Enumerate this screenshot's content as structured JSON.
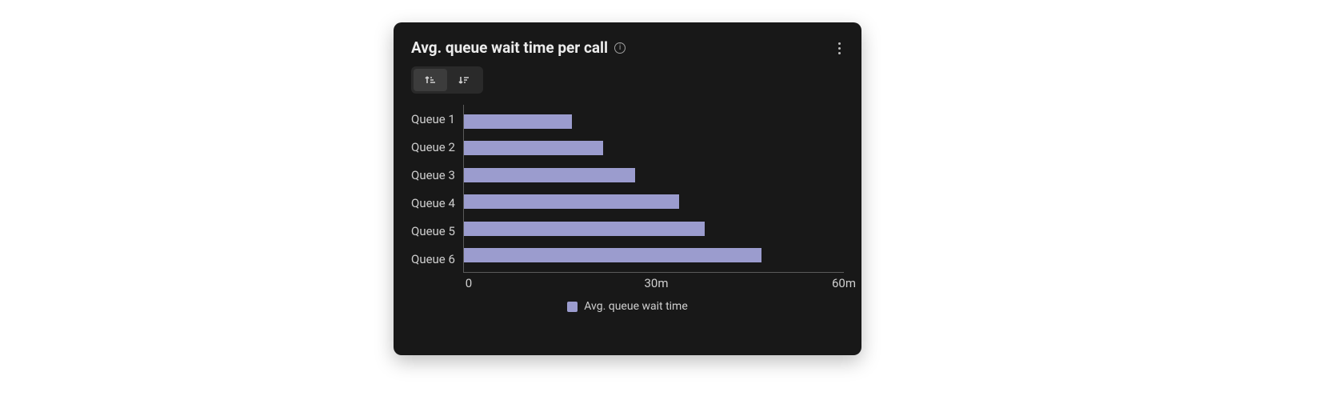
{
  "card": {
    "title": "Avg. queue wait time per call"
  },
  "legend": {
    "label": "Avg. queue wait time"
  },
  "chart_data": {
    "type": "bar",
    "orientation": "horizontal",
    "categories": [
      "Queue 1",
      "Queue 2",
      "Queue 3",
      "Queue 4",
      "Queue 5",
      "Queue 6"
    ],
    "values": [
      17,
      22,
      27,
      34,
      38,
      47
    ],
    "series": [
      {
        "name": "Avg. queue wait time",
        "values": [
          17,
          22,
          27,
          34,
          38,
          47
        ],
        "color": "#9b9cce"
      }
    ],
    "xlabel": "",
    "ylabel": "",
    "xunit": "m",
    "xlim": [
      0,
      60
    ],
    "xticks": [
      0,
      30,
      60
    ],
    "xtick_labels": [
      "0",
      "30m",
      "60m"
    ],
    "title": "Avg. queue wait time per call",
    "sort": "ascending"
  }
}
